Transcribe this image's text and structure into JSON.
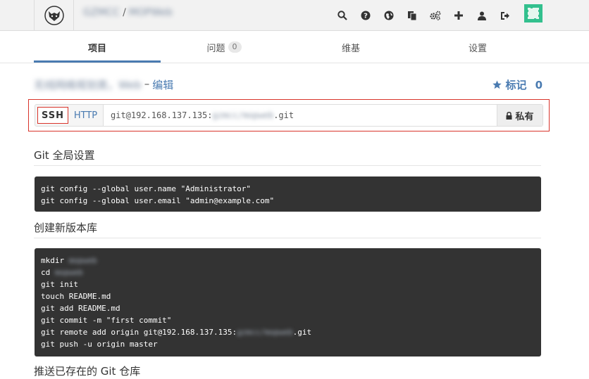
{
  "header": {
    "breadcrumb_group": "GZMCC",
    "breadcrumb_sep": "/",
    "breadcrumb_project": "MOPWeb",
    "icons": [
      "search-icon",
      "help-icon",
      "globe-icon",
      "copy-icon",
      "admin-gears-icon",
      "plus-icon",
      "user-icon",
      "sign-out-icon"
    ],
    "avatar_color": "#33c08e"
  },
  "tabs": [
    {
      "label": "项目",
      "active": true
    },
    {
      "label": "问题",
      "count": "0"
    },
    {
      "label": "维基"
    },
    {
      "label": "设置"
    }
  ],
  "project": {
    "description": "无线网络规划类，Web",
    "dash": "–",
    "edit_label": "编辑",
    "star_label": "标记",
    "star_count": "0"
  },
  "clone": {
    "ssh_label": "SSH",
    "http_label": "HTTP",
    "url_prefix": "git@192.168.137.135:",
    "url_blurred": "gzmcc/mopweb",
    "url_suffix": ".git",
    "private_label": "私有"
  },
  "sections": {
    "global_title": "Git 全局设置",
    "global_lines": [
      "git config --global user.name \"Administrator\"",
      "git config --global user.email \"admin@example.com\""
    ],
    "new_repo_title": "创建新版本库",
    "new_repo": {
      "mkdir": "mkdir ",
      "mkdir_name": "mopweb",
      "cd": "cd ",
      "cd_name": "mopweb",
      "l3": "git init",
      "l4": "touch README.md",
      "l5": "git add README.md",
      "l6": "git commit -m \"first commit\"",
      "remote_prefix": "git remote add origin git@192.168.137.135:",
      "remote_blur": "gzmcc/mopweb",
      "remote_suffix": ".git",
      "l8": "git push -u origin master"
    },
    "existing_title": "推送已存在的 Git 仓库"
  },
  "colors": {
    "accent": "#4a7bb1",
    "highlight_border": "#d9342b",
    "code_bg": "#333333"
  }
}
